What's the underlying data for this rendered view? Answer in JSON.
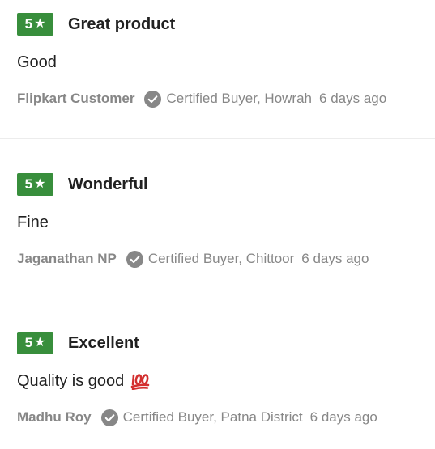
{
  "reviews": [
    {
      "rating": "5",
      "title": "Great product",
      "body": "Good",
      "has_emoji": false,
      "author": "Flipkart Customer",
      "certified": "Certified Buyer, Howrah",
      "date": "6 days ago"
    },
    {
      "rating": "5",
      "title": "Wonderful",
      "body": "Fine",
      "has_emoji": false,
      "author": "Jaganathan NP",
      "certified": "Certified Buyer, Chittoor",
      "date": "6 days ago"
    },
    {
      "rating": "5",
      "title": "Excellent",
      "body": "Quality is good",
      "has_emoji": true,
      "emoji": "💯",
      "author": "Madhu Roy",
      "certified": "Certified Buyer, Patna District",
      "date": "6 days ago"
    }
  ],
  "colors": {
    "rating_badge": "#388e3c",
    "meta_text": "#878787",
    "primary_text": "#212121",
    "divider": "#ececec"
  },
  "icons": {
    "rating": "star-icon",
    "certified": "check-circle-icon",
    "emoji": "hundred-points-emoji"
  }
}
